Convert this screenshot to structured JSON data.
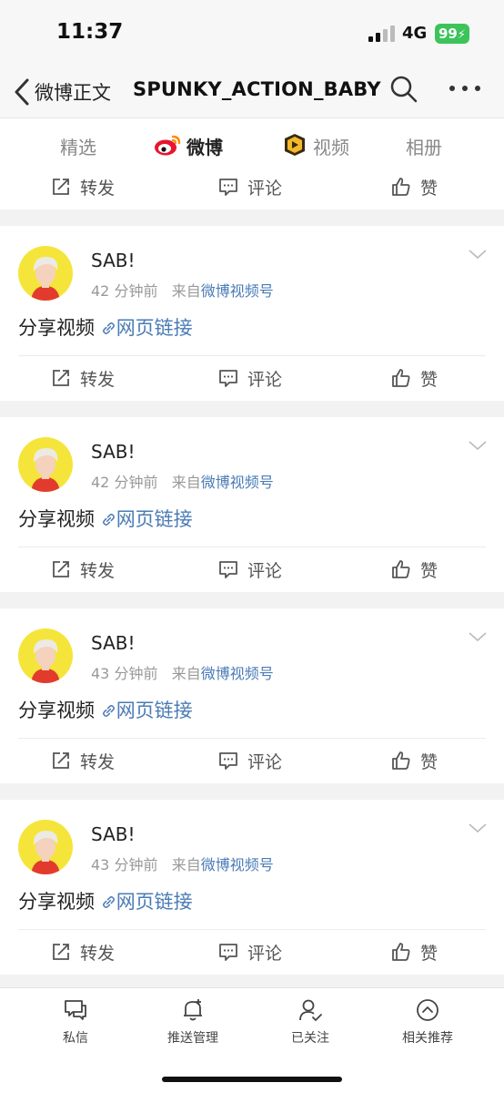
{
  "status": {
    "time": "11:37",
    "network": "4G",
    "battery": "99"
  },
  "nav": {
    "back_label": "微博正文",
    "title": "SPUNKY_ACTION_BABY"
  },
  "tabs": [
    {
      "label": "精选"
    },
    {
      "label": "微博"
    },
    {
      "label": "视频"
    },
    {
      "label": "相册"
    }
  ],
  "top_actions": {
    "repost": "转发",
    "comment": "评论",
    "like": "赞"
  },
  "posts": [
    {
      "user": "SAB!",
      "time": "42 分钟前",
      "from": "来自",
      "source": "微博视频号",
      "text": "分享视频",
      "link": "网页链接",
      "repost": "转发",
      "comment": "评论",
      "like": "赞"
    },
    {
      "user": "SAB!",
      "time": "42 分钟前",
      "from": "来自",
      "source": "微博视频号",
      "text": "分享视频",
      "link": "网页链接",
      "repost": "转发",
      "comment": "评论",
      "like": "赞"
    },
    {
      "user": "SAB!",
      "time": "43 分钟前",
      "from": "来自",
      "source": "微博视频号",
      "text": "分享视频",
      "link": "网页链接",
      "repost": "转发",
      "comment": "评论",
      "like": "赞"
    },
    {
      "user": "SAB!",
      "time": "43 分钟前",
      "from": "来自",
      "source": "微博视频号",
      "text": "分享视频",
      "link": "网页链接",
      "repost": "转发",
      "comment": "评论",
      "like": "赞"
    }
  ],
  "tabbar": [
    {
      "label": "私信",
      "icon": "message-icon"
    },
    {
      "label": "推送管理",
      "icon": "bell-icon"
    },
    {
      "label": "已关注",
      "icon": "user-check-icon"
    },
    {
      "label": "相关推荐",
      "icon": "chevron-circle-icon"
    }
  ],
  "colors": {
    "accent": "#ff7a2e",
    "link": "#4a7bb5",
    "battery": "#3cc35a",
    "avatar_bg": "#f5e53a"
  }
}
